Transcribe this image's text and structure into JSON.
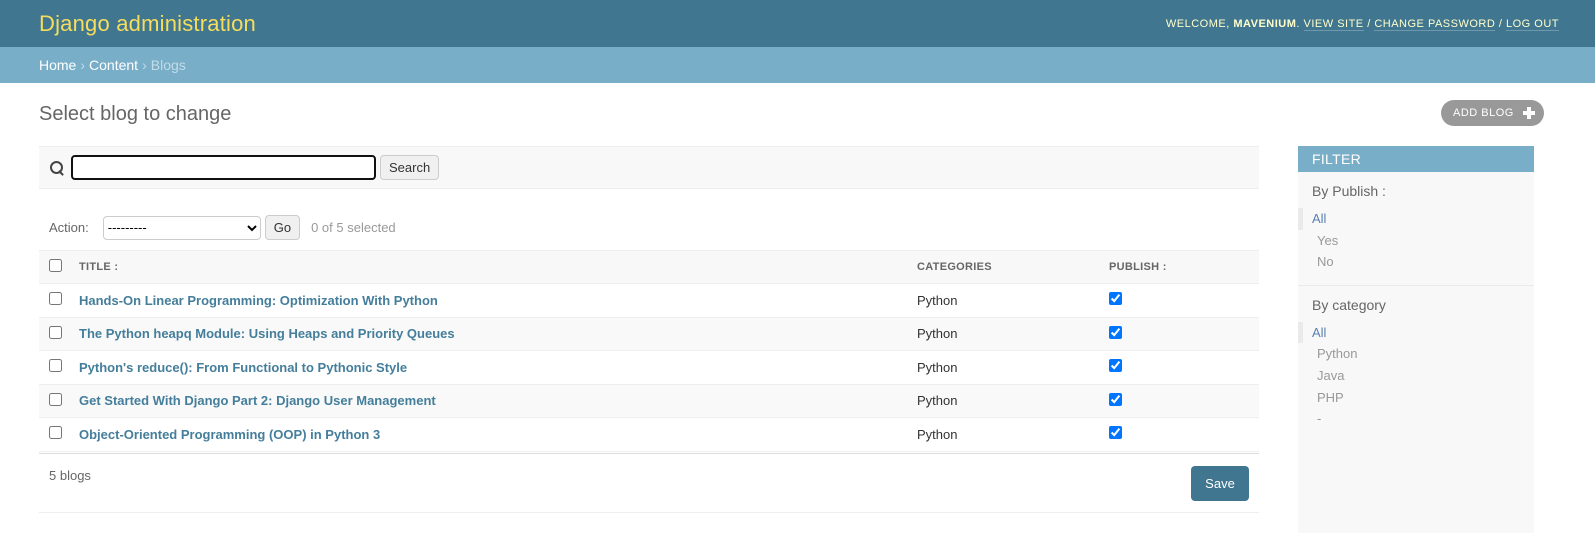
{
  "header": {
    "site_name": "Django administration",
    "welcome": "Welcome,",
    "username": "mavenium",
    "view_site": "View site",
    "change_password": "Change password",
    "log_out": "Log out"
  },
  "breadcrumbs": {
    "home": "Home",
    "content": "Content",
    "current": "Blogs",
    "separator": "›"
  },
  "page": {
    "title": "Select blog to change",
    "add_button": "Add blog"
  },
  "search": {
    "value": "",
    "button": "Search"
  },
  "actions": {
    "label": "Action:",
    "selected_option": "---------",
    "go_button": "Go",
    "counter": "0 of 5 selected"
  },
  "table": {
    "columns": [
      "Title :",
      "Categories",
      "Publish :"
    ],
    "rows": [
      {
        "title": "Hands-On Linear Programming: Optimization With Python",
        "category": "Python",
        "publish": true
      },
      {
        "title": "The Python heapq Module: Using Heaps and Priority Queues",
        "category": "Python",
        "publish": true
      },
      {
        "title": "Python's reduce(): From Functional to Pythonic Style",
        "category": "Python",
        "publish": true
      },
      {
        "title": "Get Started With Django Part 2: Django User Management",
        "category": "Python",
        "publish": true
      },
      {
        "title": "Object-Oriented Programming (OOP) in Python 3",
        "category": "Python",
        "publish": true
      }
    ]
  },
  "paginator": {
    "count": "5 blogs",
    "save_button": "Save"
  },
  "filter": {
    "title": "Filter",
    "groups": [
      {
        "heading": "By Publish :",
        "options": [
          "All",
          "Yes",
          "No"
        ],
        "selected": "All"
      },
      {
        "heading": "By category",
        "options": [
          "All",
          "Python",
          "Java",
          "PHP",
          "-"
        ],
        "selected": "All"
      }
    ]
  },
  "colors": {
    "header_bg": "#417690",
    "site_name": "#f5dd5d",
    "breadcrumb_bg": "#79aec8",
    "link": "#447e9b",
    "save_button_bg": "#417690"
  }
}
